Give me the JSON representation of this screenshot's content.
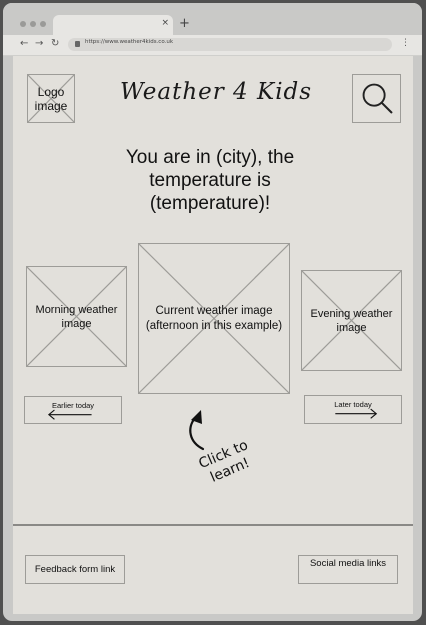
{
  "browser": {
    "url": "https://www.weather4kids.co.uk",
    "tab_close": "×",
    "new_tab": "+",
    "back": "←",
    "forward": "→",
    "reload": "↻",
    "menu": "⋮"
  },
  "header": {
    "logo_label": "Logo image",
    "title": "Weather 4 Kids",
    "search_icon": "magnifier"
  },
  "headline": "You are in (city), the temperature is (temperature)!",
  "weather": {
    "morning_label": "Morning weather image",
    "current_label": "Current weather image (afternoon in this example)",
    "evening_label": "Evening weather image"
  },
  "nav": {
    "earlier_label": "Earlier today",
    "later_label": "Later today"
  },
  "hint": "Click to learn!",
  "footer": {
    "feedback_label": "Feedback form link",
    "social_label": "Social media links"
  },
  "colors": {
    "page_bg": "#e2e0db",
    "frame_bg": "#c9c9c7",
    "wire_border": "#9d9c98"
  }
}
